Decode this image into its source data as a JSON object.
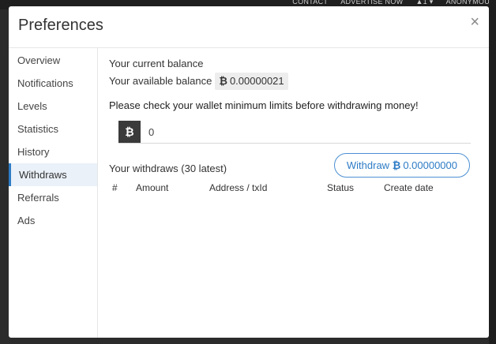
{
  "background_nav": {
    "items": [
      "CONTACT",
      "ADVERTISE NOW",
      "▲1 ▾",
      "ANONYMOU"
    ]
  },
  "modal": {
    "title": "Preferences",
    "close_label": "×"
  },
  "sidebar": {
    "items": [
      {
        "label": "Overview"
      },
      {
        "label": "Notifications"
      },
      {
        "label": "Levels"
      },
      {
        "label": "Statistics"
      },
      {
        "label": "History"
      },
      {
        "label": "Withdraws",
        "active": true
      },
      {
        "label": "Referrals"
      },
      {
        "label": "Ads"
      }
    ]
  },
  "content": {
    "balance_title": "Your current balance",
    "available_label": "Your available balance",
    "currency_symbol": "₿",
    "available_value": "0.00000021",
    "notice": "Please check your wallet minimum limits before withdrawing money!",
    "amount_input_value": "0",
    "withdraws_label": "Your withdraws (30 latest)",
    "withdraw_button": {
      "label": "Withdraw",
      "symbol": "₿",
      "amount": "0.00000000"
    },
    "table_headers": [
      "#",
      "Amount",
      "Address / txId",
      "Status",
      "Create date"
    ]
  },
  "colors": {
    "accent": "#2d7cc5",
    "active_bg": "#eaf1f8",
    "chip_bg": "#ededed",
    "btc_square": "#3a3a3a"
  }
}
